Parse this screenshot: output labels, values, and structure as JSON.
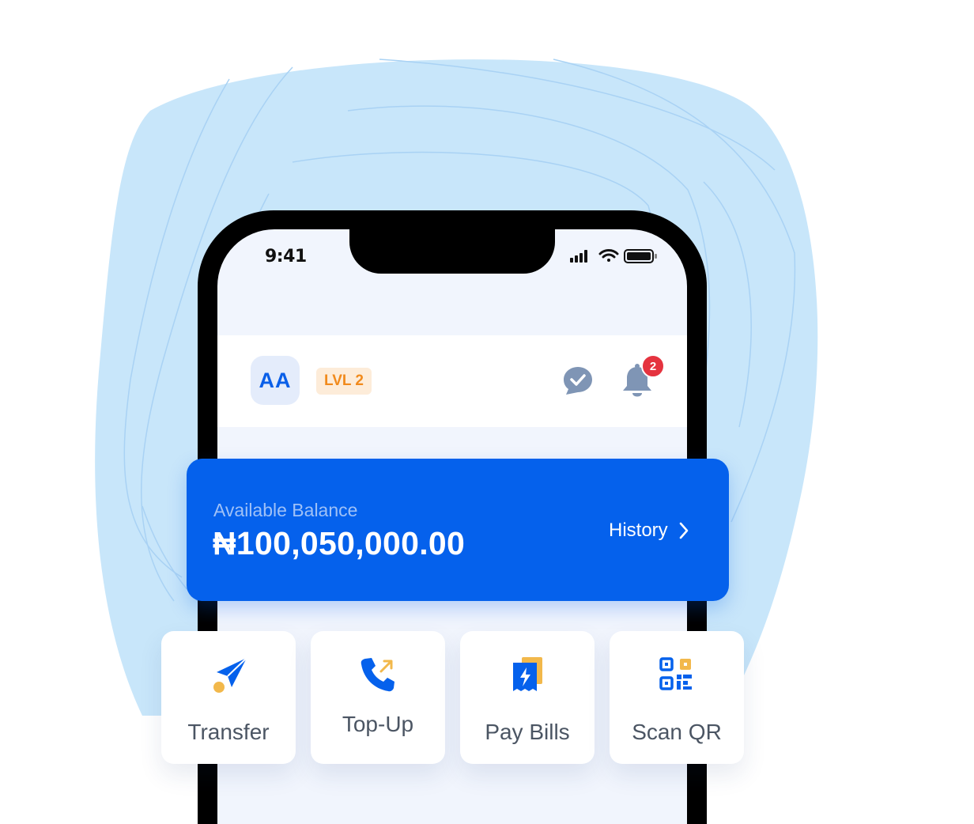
{
  "status_bar": {
    "time": "9:41"
  },
  "header": {
    "avatar_initials": "AA",
    "level_badge": "LVL 2",
    "notification_count": "2"
  },
  "balance": {
    "label": "Available Balance",
    "amount": "₦100,050,000.00",
    "history_label": "History"
  },
  "actions": [
    {
      "label": "Transfer",
      "icon": "send-icon"
    },
    {
      "label": "Top-Up",
      "icon": "phone-topup-icon"
    },
    {
      "label": "Pay Bills",
      "icon": "bill-icon"
    },
    {
      "label": "Scan QR",
      "icon": "qr-code-icon"
    }
  ],
  "colors": {
    "primary": "#0561ec",
    "accent_yellow": "#f2b84b",
    "level_orange": "#f18a1c",
    "badge_red": "#e5333f",
    "background_blob": "#c8e6fa"
  }
}
